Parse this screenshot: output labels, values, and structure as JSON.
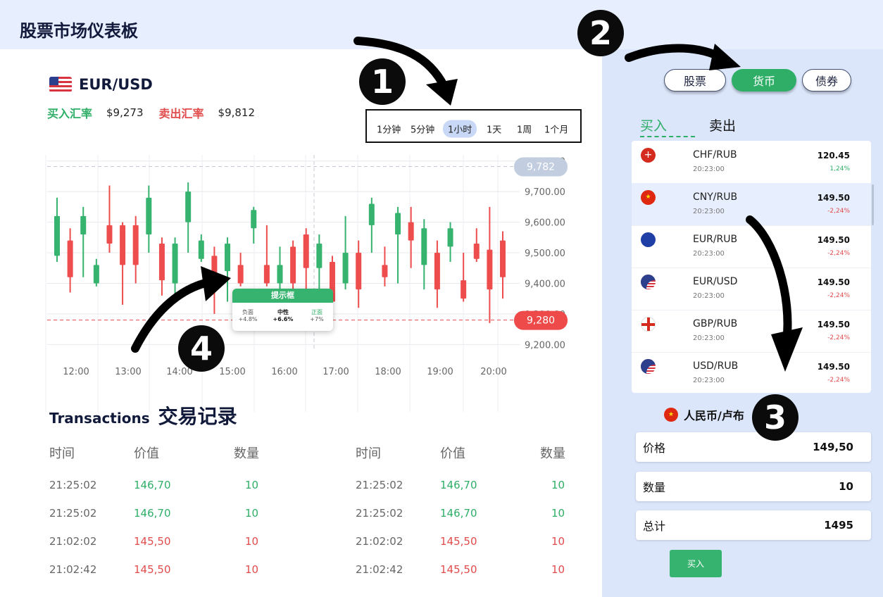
{
  "app": {
    "title": "股票市场仪表板"
  },
  "pair": {
    "name": "EUR/USD",
    "buy_label": "买入汇率",
    "buy_value": "$9,273",
    "sell_label": "卖出汇率",
    "sell_value": "$9,812"
  },
  "timeframes": [
    "1分钟",
    "5分钟",
    "1小时",
    "1天",
    "1周",
    "1个月"
  ],
  "timeframe_selected": "1小时",
  "chart_data": {
    "type": "candlestick",
    "x_ticks": [
      "12:00",
      "13:00",
      "14:00",
      "15:00",
      "16:00",
      "17:00",
      "18:00",
      "19:00",
      "20:00"
    ],
    "y_ticks": [
      "9,800.00",
      "9,700.00",
      "9,600.00",
      "9,500.00",
      "9,400.00",
      "9,300.00",
      "9,200.00"
    ],
    "ylim": [
      9180,
      9820
    ],
    "high_marker": "9,782",
    "low_marker": "9,280",
    "up_color": "#36b36e",
    "down_color": "#ee4d4d",
    "candles": [
      {
        "o": 9490,
        "c": 9620,
        "h": 9680,
        "l": 9470
      },
      {
        "o": 9540,
        "c": 9420,
        "h": 9580,
        "l": 9370
      },
      {
        "o": 9560,
        "c": 9620,
        "h": 9650,
        "l": 9420
      },
      {
        "o": 9400,
        "c": 9460,
        "h": 9480,
        "l": 9390
      },
      {
        "o": 9590,
        "c": 9530,
        "h": 9720,
        "l": 9500
      },
      {
        "o": 9590,
        "c": 9460,
        "h": 9600,
        "l": 9330
      },
      {
        "o": 9590,
        "c": 9460,
        "h": 9620,
        "l": 9400
      },
      {
        "o": 9560,
        "c": 9680,
        "h": 9720,
        "l": 9500
      },
      {
        "o": 9530,
        "c": 9410,
        "h": 9550,
        "l": 9360
      },
      {
        "o": 9400,
        "c": 9530,
        "h": 9550,
        "l": 9360
      },
      {
        "o": 9600,
        "c": 9700,
        "h": 9730,
        "l": 9500
      },
      {
        "o": 9480,
        "c": 9540,
        "h": 9560,
        "l": 9470
      },
      {
        "o": 9490,
        "c": 9430,
        "h": 9520,
        "l": 9300
      },
      {
        "o": 9440,
        "c": 9530,
        "h": 9550,
        "l": 9340
      },
      {
        "o": 9460,
        "c": 9400,
        "h": 9500,
        "l": 9390
      },
      {
        "o": 9580,
        "c": 9640,
        "h": 9650,
        "l": 9530
      },
      {
        "o": 9460,
        "c": 9400,
        "h": 9590,
        "l": 9390
      },
      {
        "o": 9400,
        "c": 9460,
        "h": 9520,
        "l": 9380
      },
      {
        "o": 9520,
        "c": 9400,
        "h": 9540,
        "l": 9320
      },
      {
        "o": 9560,
        "c": 9450,
        "h": 9580,
        "l": 9320
      },
      {
        "o": 9450,
        "c": 9530,
        "h": 9560,
        "l": 9350
      },
      {
        "o": 9470,
        "c": 9340,
        "h": 9490,
        "l": 9300
      },
      {
        "o": 9400,
        "c": 9500,
        "h": 9620,
        "l": 9380
      },
      {
        "o": 9500,
        "c": 9380,
        "h": 9540,
        "l": 9320
      },
      {
        "o": 9590,
        "c": 9660,
        "h": 9680,
        "l": 9500
      },
      {
        "o": 9460,
        "c": 9420,
        "h": 9520,
        "l": 9390
      },
      {
        "o": 9560,
        "c": 9630,
        "h": 9650,
        "l": 9400
      },
      {
        "o": 9600,
        "c": 9540,
        "h": 9650,
        "l": 9450
      },
      {
        "o": 9460,
        "c": 9580,
        "h": 9610,
        "l": 9380
      },
      {
        "o": 9500,
        "c": 9380,
        "h": 9540,
        "l": 9320
      },
      {
        "o": 9520,
        "c": 9580,
        "h": 9600,
        "l": 9470
      },
      {
        "o": 9410,
        "c": 9350,
        "h": 9500,
        "l": 9340
      },
      {
        "o": 9530,
        "c": 9480,
        "h": 9580,
        "l": 9470
      },
      {
        "o": 9510,
        "c": 9380,
        "h": 9650,
        "l": 9270
      },
      {
        "o": 9540,
        "c": 9420,
        "h": 9570,
        "l": 9350
      }
    ]
  },
  "tooltip": {
    "title": "提示框",
    "cols": [
      {
        "label": "负面",
        "value": "+4.8%"
      },
      {
        "label": "中性",
        "value": "+6.6%"
      },
      {
        "label": "正面",
        "value": "+7%"
      }
    ]
  },
  "transactions": {
    "title_en": "Transactions",
    "title_zh": "交易记录",
    "headers": [
      "时间",
      "价值",
      "数量"
    ],
    "rows": [
      {
        "time": "21:25:02",
        "value": "146,70",
        "qty": "10",
        "dir": "up"
      },
      {
        "time": "21:25:02",
        "value": "146,70",
        "qty": "10",
        "dir": "up"
      },
      {
        "time": "21:02:02",
        "value": "145,50",
        "qty": "10",
        "dir": "down"
      },
      {
        "time": "21:02:42",
        "value": "145,50",
        "qty": "10",
        "dir": "down"
      }
    ]
  },
  "segments": [
    "股票",
    "货币",
    "债券"
  ],
  "segment_selected": "货币",
  "trade_tabs": {
    "buy": "买入",
    "sell": "卖出"
  },
  "currency_list": [
    {
      "pair": "CHF/RUB",
      "time": "20:23:00",
      "price": "120.45",
      "change": "1,24%",
      "dir": "up",
      "flag": "ch"
    },
    {
      "pair": "CNY/RUB",
      "time": "20:23:00",
      "price": "149.50",
      "change": "-2,24%",
      "dir": "down",
      "flag": "cn"
    },
    {
      "pair": "EUR/RUB",
      "time": "20:23:00",
      "price": "149.50",
      "change": "-2,24%",
      "dir": "down",
      "flag": "eu"
    },
    {
      "pair": "EUR/USD",
      "time": "20:23:00",
      "price": "149.50",
      "change": "-2,24%",
      "dir": "down",
      "flag": "us"
    },
    {
      "pair": "GBP/RUB",
      "time": "20:23:00",
      "price": "149.50",
      "change": "-2,24%",
      "dir": "down",
      "flag": "gb"
    },
    {
      "pair": "USD/RUB",
      "time": "20:23:00",
      "price": "149.50",
      "change": "-2,24%",
      "dir": "down",
      "flag": "us"
    }
  ],
  "order": {
    "currency_label": "人民币/卢布",
    "price_label": "价格",
    "price_value": "149,50",
    "qty_label": "数量",
    "qty_value": "10",
    "total_label": "总计",
    "total_value": "1495",
    "buy_button": "买入"
  },
  "callouts": [
    "1",
    "2",
    "3",
    "4"
  ],
  "colors": {
    "green": "#2eae67",
    "red": "#e24b4b",
    "panel": "#dbe6fb"
  }
}
